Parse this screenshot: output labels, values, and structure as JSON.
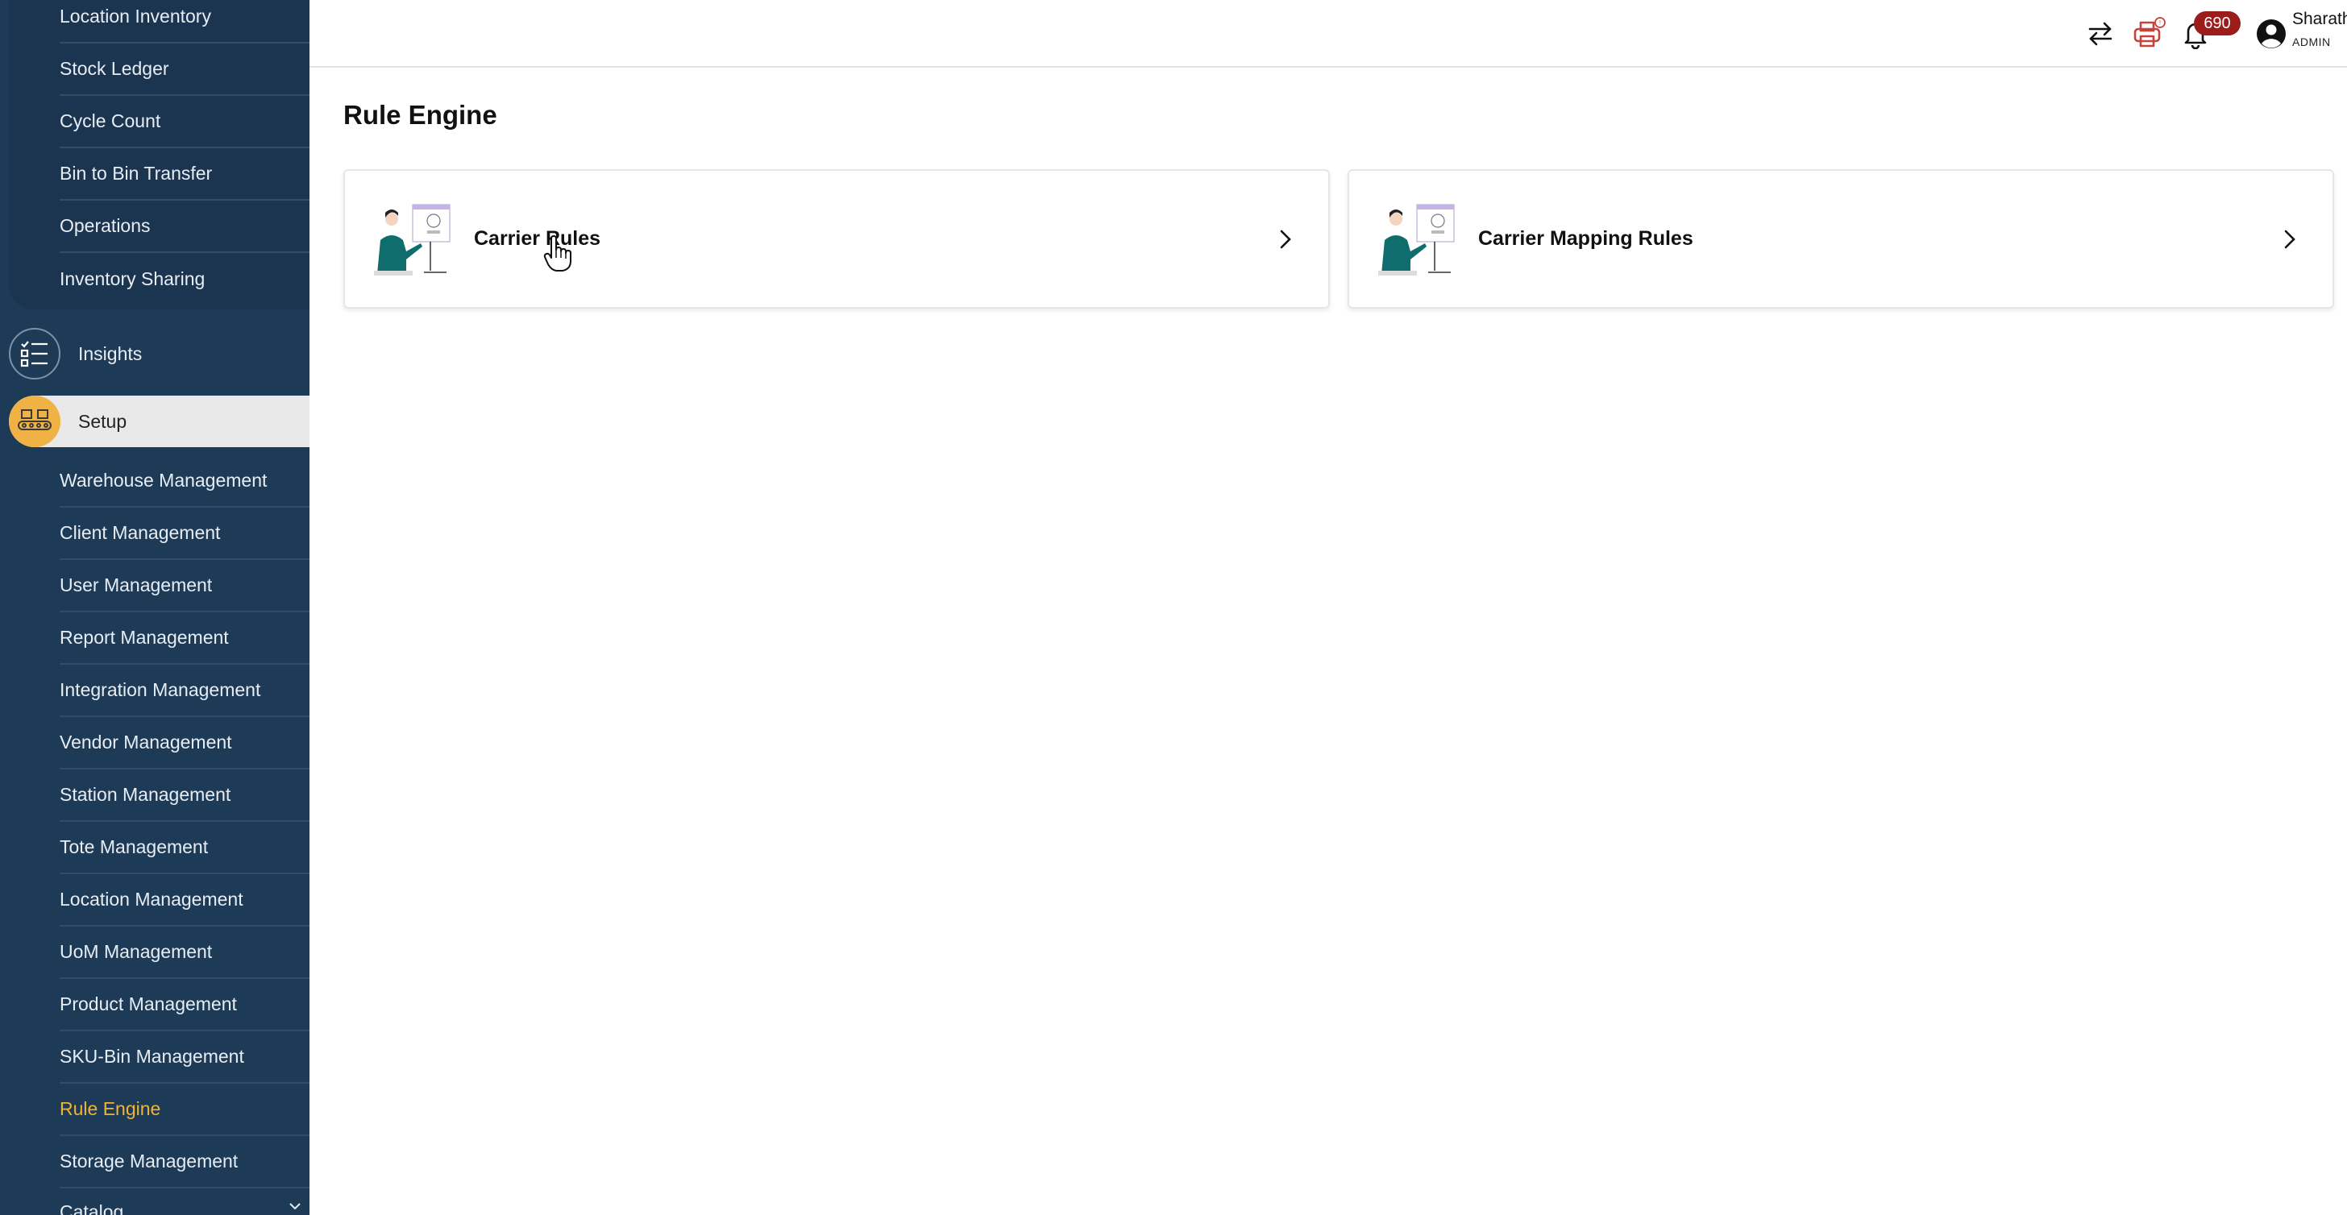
{
  "sidebar": {
    "inventory_items": [
      {
        "label": "Location Inventory"
      },
      {
        "label": "Stock Ledger"
      },
      {
        "label": "Cycle Count"
      },
      {
        "label": "Bin to Bin Transfer"
      },
      {
        "label": "Operations"
      },
      {
        "label": "Inventory Sharing"
      }
    ],
    "insights_label": "Insights",
    "setup_label": "Setup",
    "setup_items": [
      {
        "label": "Warehouse Management"
      },
      {
        "label": "Client Management"
      },
      {
        "label": "User Management"
      },
      {
        "label": "Report Management"
      },
      {
        "label": "Integration Management"
      },
      {
        "label": "Vendor Management"
      },
      {
        "label": "Station Management"
      },
      {
        "label": "Tote Management"
      },
      {
        "label": "Location Management"
      },
      {
        "label": "UoM Management"
      },
      {
        "label": "Product Management"
      },
      {
        "label": "SKU-Bin Management"
      },
      {
        "label": "Rule Engine",
        "active": true
      },
      {
        "label": "Storage Management"
      },
      {
        "label": "Catalog"
      }
    ],
    "active_color": "#f2b233"
  },
  "header": {
    "notification_count": "690",
    "user_name": "Sharath",
    "user_role": "ADMIN"
  },
  "main": {
    "title": "Rule Engine",
    "cards": [
      {
        "label": "Carrier Rules"
      },
      {
        "label": "Carrier Mapping Rules"
      }
    ]
  }
}
